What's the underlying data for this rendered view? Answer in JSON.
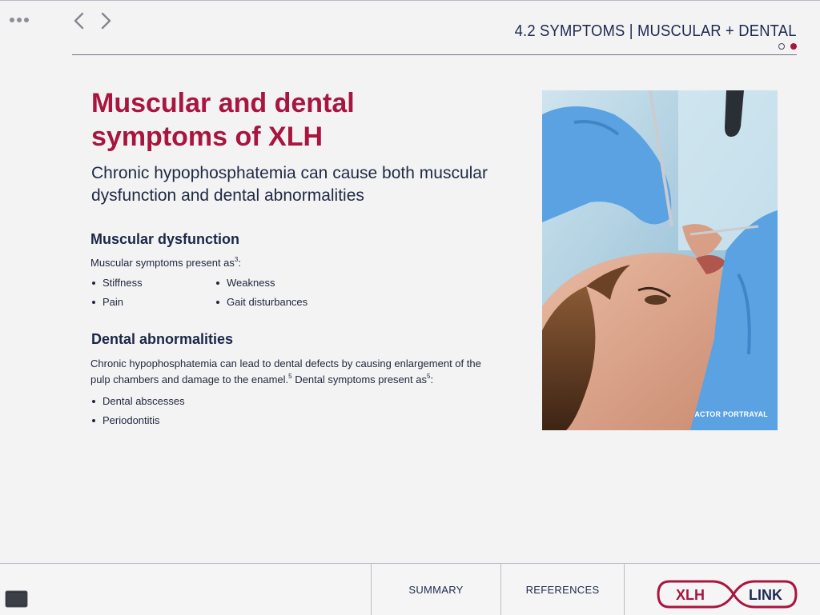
{
  "header": {
    "menu_icon": "more-dots-icon",
    "back_icon": "chevron-left-icon",
    "forward_icon": "chevron-right-icon",
    "section_title": "4.2 SYMPTOMS | MUSCULAR + DENTAL",
    "page_indicator": {
      "total": 2,
      "current": 2
    }
  },
  "main": {
    "title": "Muscular and dental symptoms of XLH",
    "subtitle": "Chronic hypophosphatemia can cause both muscular dysfunction and dental abnormalities",
    "muscular": {
      "heading": "Muscular dysfunction",
      "intro": "Muscular symptoms present as",
      "intro_ref": "3",
      "intro_end": ":",
      "bullets": [
        "Stiffness",
        "Pain",
        "Weakness",
        "Gait disturbances"
      ]
    },
    "dental": {
      "heading": "Dental abnormalities",
      "text_a": "Chronic hypophosphatemia can lead to dental defects by causing enlargement of the pulp chambers and damage to the enamel.",
      "text_a_ref": "5",
      "text_b": " Dental symptoms present as",
      "text_b_ref": "5",
      "text_b_end": ":",
      "bullets": [
        "Dental abscesses",
        "Periodontitis"
      ]
    },
    "photo": {
      "caption": "ACTOR PORTRAYAL"
    }
  },
  "footer": {
    "thumbnail_icon": "slides-thumbnail-icon",
    "summary_label": "SUMMARY",
    "references_label": "REFERENCES",
    "logo": {
      "left": "XLH",
      "right": "LINK"
    }
  },
  "colors": {
    "accent": "#a8163f",
    "navy": "#1d2a4d",
    "background": "#f3f3f4"
  }
}
